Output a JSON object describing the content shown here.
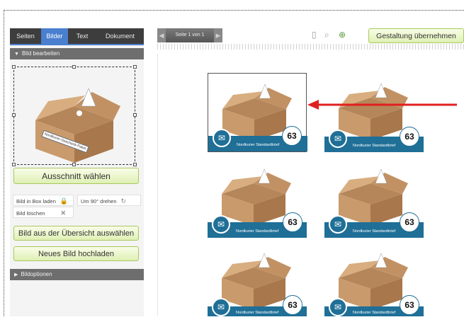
{
  "tabs": [
    "Seiten",
    "Bilder",
    "Text",
    "Dokument"
  ],
  "active_tab": "Bilder",
  "sections": {
    "bild_bearbeiten": "Bild bearbeiten",
    "bildoptionen": "Bildoptionen"
  },
  "buttons": {
    "ausschnitt": "Ausschnitt wählen",
    "aus_uebersicht": "Bild aus der Übersicht auswählen",
    "hochladen": "Neues Bild hochladen",
    "gestaltung": "Gestaltung übernehmen"
  },
  "actions": {
    "box_laden": "Bild in Box laden",
    "drehen": "Um 90° drehen",
    "loeschen": "Bild löschen"
  },
  "pager": {
    "label": "Seite 1 von 1"
  },
  "tile": {
    "band_label": "Nordkurier Standardbrief",
    "number": "63",
    "box_label": "Nordkurier-Geschenk-Paket"
  },
  "colors": {
    "accent_blue": "#4a7fcf",
    "band_blue": "#1f6f97",
    "button_green": "#dff0b4",
    "arrow_red": "#e02020"
  },
  "icons": [
    "lock-icon",
    "rotate-icon",
    "delete-x-icon",
    "page-icon",
    "zoom-out-icon",
    "zoom-in-icon",
    "envelope-icon"
  ]
}
